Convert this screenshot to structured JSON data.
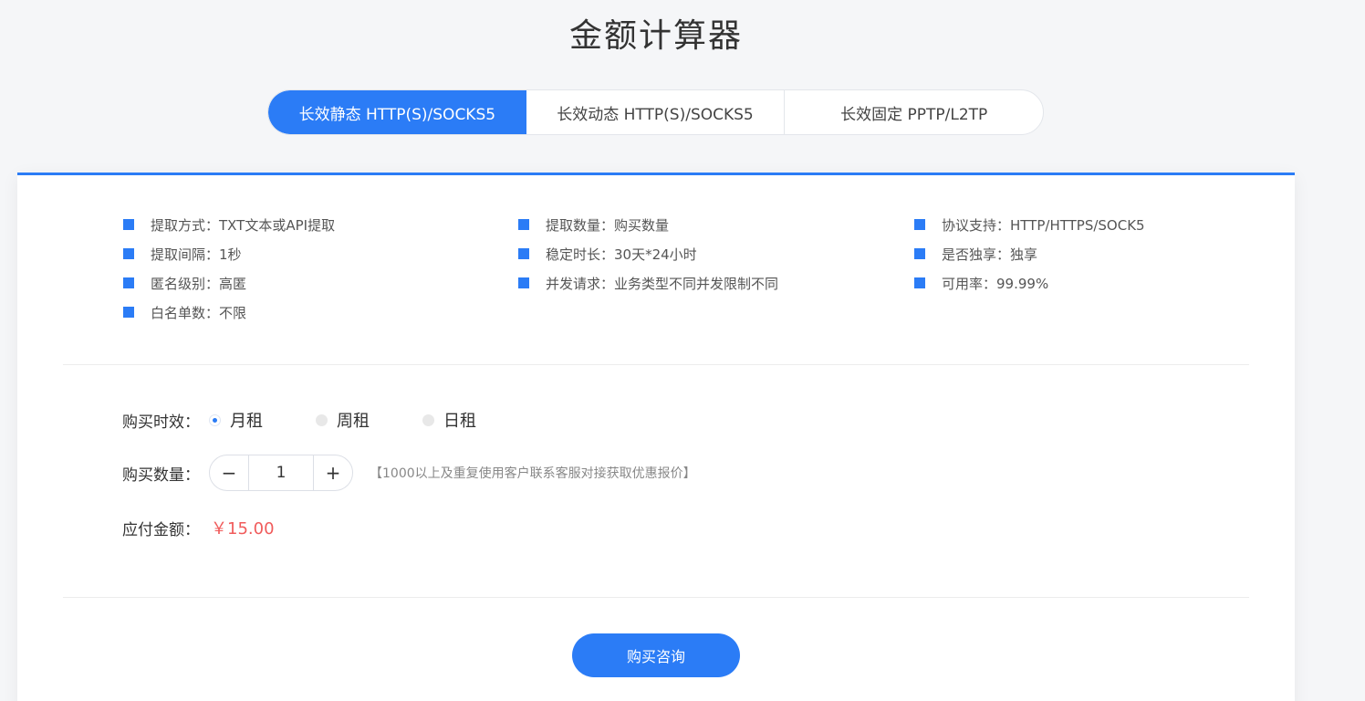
{
  "title": "金额计算器",
  "tabs": [
    {
      "label": "长效静态 HTTP(S)/SOCKS5",
      "active": true
    },
    {
      "label": "长效动态 HTTP(S)/SOCKS5",
      "active": false
    },
    {
      "label": "长效固定 PPTP/L2TP",
      "active": false
    }
  ],
  "features": {
    "col1": [
      "提取方式：TXT文本或API提取",
      "提取间隔：1秒",
      "匿名级别：高匿",
      "白名单数：不限"
    ],
    "col2": [
      "提取数量：购买数量",
      "稳定时长：30天*24小时",
      "并发请求：业务类型不同并发限制不同"
    ],
    "col3": [
      "协议支持：HTTP/HTTPS/SOCK5",
      "是否独享：独享",
      "可用率：99.99%"
    ]
  },
  "purchase": {
    "period_label": "购买时效：",
    "period_options": [
      {
        "label": "月租",
        "checked": true
      },
      {
        "label": "周租",
        "checked": false
      },
      {
        "label": "日租",
        "checked": false
      }
    ],
    "quantity_label": "购买数量：",
    "quantity_value": "1",
    "minus": "−",
    "plus": "+",
    "quantity_hint": "【1000以上及重复使用客户联系客服对接获取优惠报价】",
    "amount_label": "应付金额：",
    "amount_value": "￥15.00"
  },
  "buy_button": "购买咨询",
  "colors": {
    "accent": "#2b7cf6",
    "price": "#f05b5b"
  }
}
